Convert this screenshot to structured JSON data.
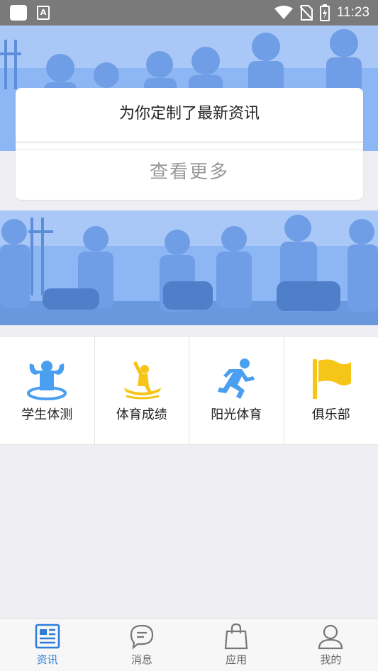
{
  "status_bar": {
    "time": "11:23",
    "notification_letter": "A"
  },
  "dialog": {
    "title": "为你定制了最新资讯",
    "more_label": "查看更多"
  },
  "grid": [
    {
      "label": "学生体测",
      "icon": "athlete-muscle-icon"
    },
    {
      "label": "体育成绩",
      "icon": "kayak-icon"
    },
    {
      "label": "阳光体育",
      "icon": "running-man-icon"
    },
    {
      "label": "俱乐部",
      "icon": "flag-icon"
    }
  ],
  "nav": [
    {
      "label": "资讯",
      "icon": "news-icon",
      "active": true
    },
    {
      "label": "消息",
      "icon": "chat-bubble-icon",
      "active": false
    },
    {
      "label": "应用",
      "icon": "shopping-bag-icon",
      "active": false
    },
    {
      "label": "我的",
      "icon": "user-icon",
      "active": false
    }
  ],
  "colors": {
    "accent_blue": "#2e7cd6",
    "icon_blue": "#4a9ff0",
    "icon_yellow": "#f5c518",
    "banner_tint": "#8fb8f5"
  }
}
